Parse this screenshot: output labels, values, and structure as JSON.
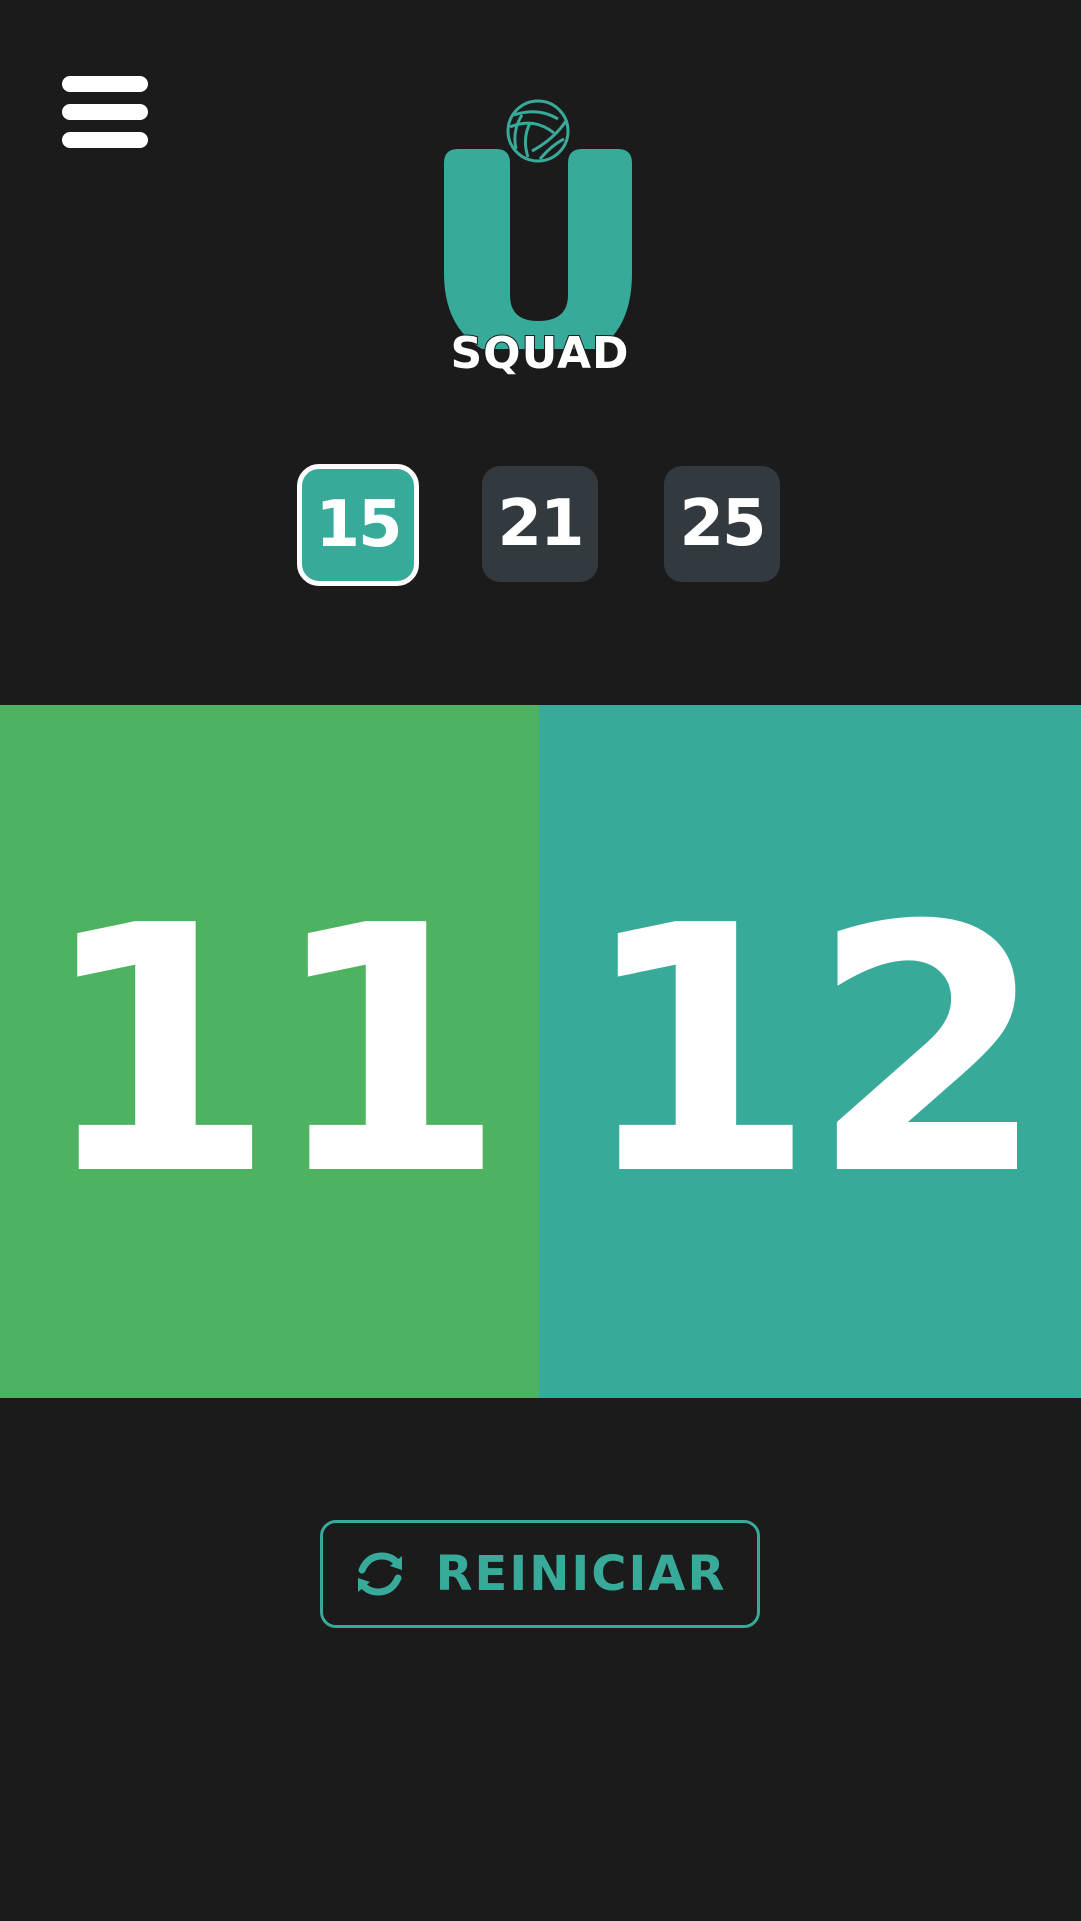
{
  "header": {
    "menu_icon": "hamburger-menu-icon",
    "logo": {
      "icon": "volleyball-icon",
      "letter": "U",
      "wordmark": "SQUAD"
    }
  },
  "presets": {
    "options": [
      {
        "label": "15",
        "active": true
      },
      {
        "label": "21",
        "active": false
      },
      {
        "label": "25",
        "active": false
      }
    ]
  },
  "score": {
    "left": {
      "value": "11",
      "color": "#4db361"
    },
    "right": {
      "value": "12",
      "color": "#38aa99"
    }
  },
  "reset": {
    "icon": "refresh-icon",
    "label": "REINICIAR"
  },
  "colors": {
    "background": "#1b1b1b",
    "accent": "#38aa99",
    "inactive_preset": "#323a3f"
  }
}
